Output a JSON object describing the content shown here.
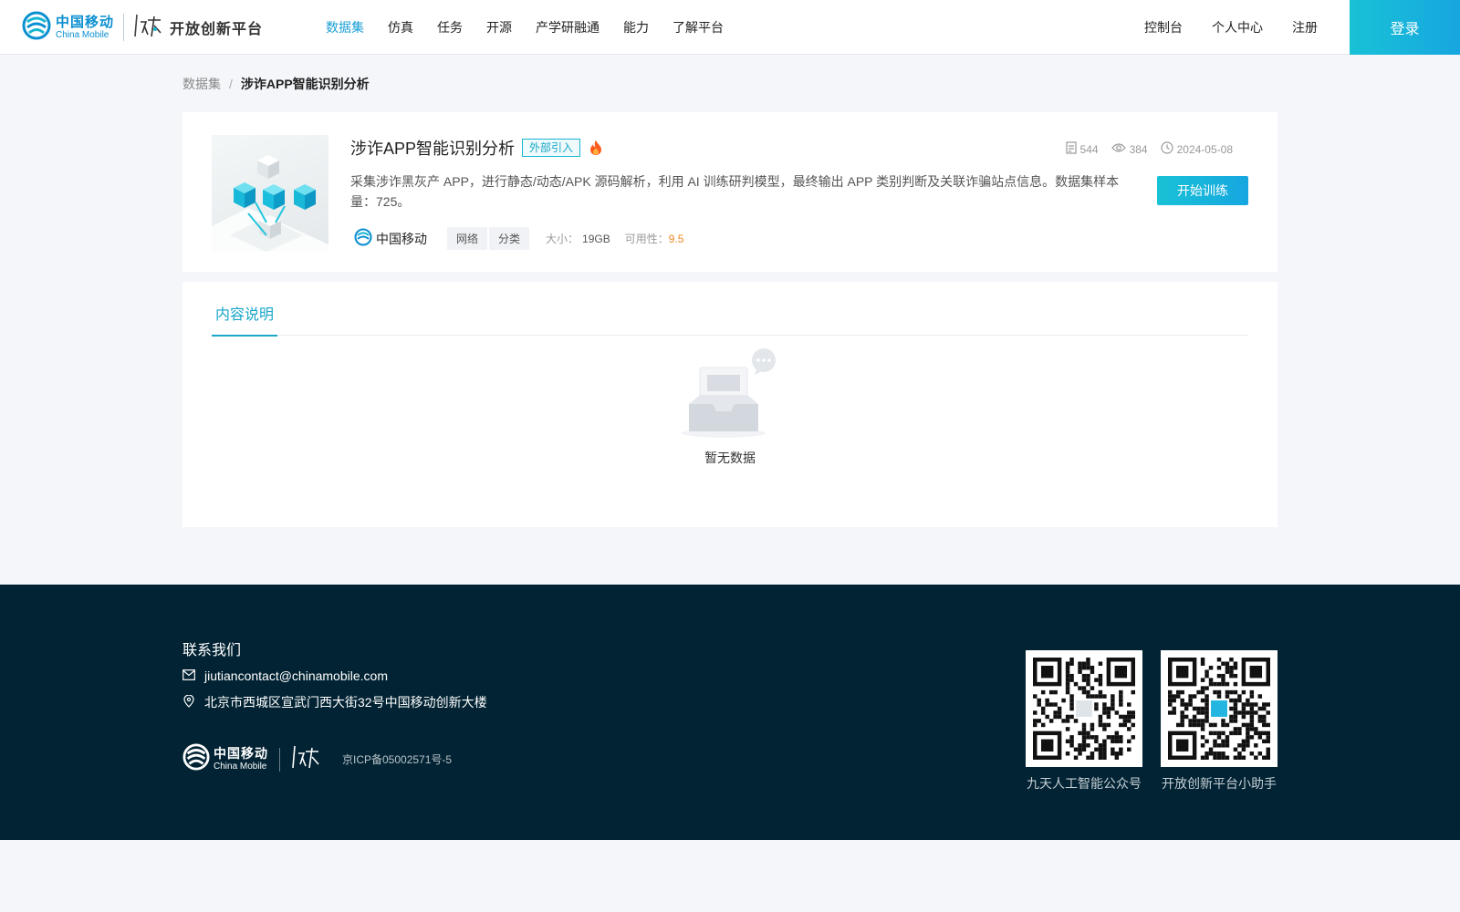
{
  "header": {
    "brand_cn": "中国移动",
    "brand_en": "China Mobile",
    "platform_name": "开放创新平台",
    "nav": [
      {
        "label": "数据集",
        "active": true
      },
      {
        "label": "仿真"
      },
      {
        "label": "任务"
      },
      {
        "label": "开源"
      },
      {
        "label": "产学研融通"
      },
      {
        "label": "能力"
      },
      {
        "label": "了解平台"
      }
    ],
    "right_links": [
      "控制台",
      "个人中心",
      "注册"
    ],
    "login_label": "登录"
  },
  "breadcrumb": {
    "root": "数据集",
    "separator": "/",
    "current": "涉诈APP智能识别分析"
  },
  "dataset": {
    "title": "涉诈APP智能识别分析",
    "source_tag": "外部引入",
    "stats": {
      "records": "544",
      "views": "384",
      "date": "2024-05-08"
    },
    "description": "采集涉诈黑灰产 APP，进行静态/动态/APK 源码解析，利用 AI 训练研判模型，最终输出 APP 类别判断及关联诈骗站点信息。数据集样本量：725。",
    "train_button": "开始训练",
    "provider": "中国移动",
    "chips": [
      "网络",
      "分类"
    ],
    "size_label": "大小：",
    "size_value": "19GB",
    "usability_label": "可用性：",
    "usability_value": "9.5"
  },
  "content": {
    "tab_label": "内容说明",
    "empty_text": "暂无数据"
  },
  "footer": {
    "contact_title": "联系我们",
    "email": "jiutiancontact@chinamobile.com",
    "address": "北京市西城区宣武门西大街32号中国移动创新大楼",
    "logo_cn": "中国移动",
    "logo_en": "China Mobile",
    "icp": "京ICP备05002571号-5",
    "qr_codes": [
      {
        "label": "九天人工智能公众号"
      },
      {
        "label": "开放创新平台小助手"
      }
    ]
  },
  "colors": {
    "accent": "#1a9fd6",
    "footer_bg": "#022333",
    "score": "#f08a24"
  },
  "icons": [
    "china-mobile-logo",
    "jiutian-logo",
    "fire-icon",
    "record-icon",
    "eye-icon",
    "clock-icon",
    "mail-icon",
    "location-icon",
    "empty-inbox-icon",
    "qr-code"
  ]
}
